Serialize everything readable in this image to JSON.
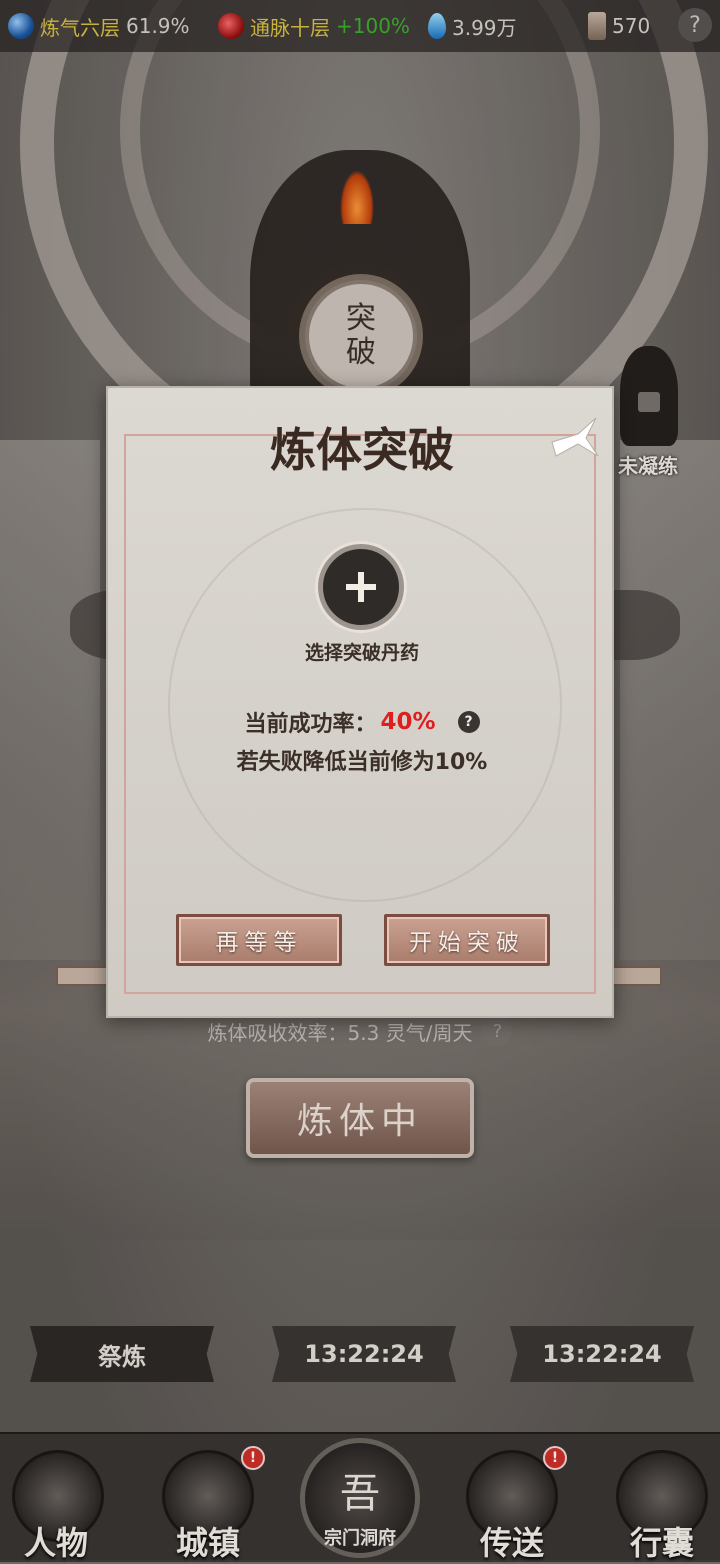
{
  "topbar": {
    "stat1_label": "炼气六层",
    "stat1_value": "61.9%",
    "stat2_label": "通脉十层",
    "stat2_value": "+100%",
    "stat3_value": "3.99万",
    "stat4_value": "570",
    "help": "?"
  },
  "scene": {
    "seal_top": "突",
    "seal_bottom": "破",
    "locked_label": "未凝练",
    "absorb_text": "炼体吸收效率：5.3 灵气/周天",
    "absorb_help": "?",
    "train_button": "炼体中"
  },
  "timers": {
    "refine_label": "祭炼",
    "timer1": "13:22:24",
    "timer2": "13:22:24"
  },
  "nav": {
    "item1": "人物",
    "item2": "城镇",
    "center_glyph": "吾",
    "center_label": "宗门洞府",
    "item4": "传送",
    "item5": "行囊",
    "badge": "!"
  },
  "dialog": {
    "title": "炼体突破",
    "pill_label": "选择突破丹药",
    "rate_label": "当前成功率：",
    "rate_value": "40%",
    "rate_help": "?",
    "fail_text": "若失败降低当前修为10%",
    "wait_button": "再等等",
    "start_button": "开始突破"
  },
  "colors": {
    "success_rate": "#e01e1e",
    "stat1": "#d8c244",
    "stat2": "#d8c244",
    "stat2_value": "#3fae2f",
    "badge": "#d0302a"
  }
}
